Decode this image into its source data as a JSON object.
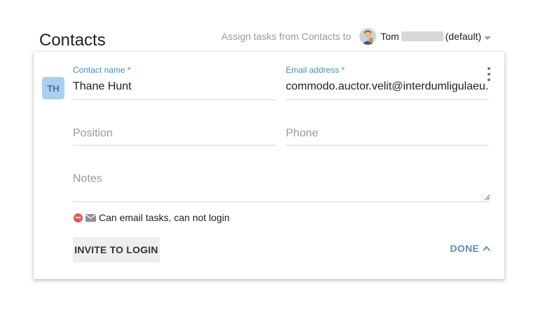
{
  "header": {
    "title": "Contacts",
    "assign_label": "Assign tasks from Contacts to",
    "assignee_name": "Tom",
    "assignee_default": "(default)"
  },
  "contact": {
    "initials": "TH",
    "name_label": "Contact name *",
    "name_value": "Thane Hunt",
    "email_label": "Email address *",
    "email_value": "commodo.auctor.velit@interdumligulaeu.",
    "position_placeholder": "Position",
    "phone_placeholder": "Phone",
    "notes_placeholder": "Notes",
    "status_text": "Can email tasks, can not login"
  },
  "actions": {
    "invite_label": "INVITE TO LOGIN",
    "done_label": "DONE"
  },
  "icons": {
    "kebab": "more-vert-icon",
    "status_blocked": "no-entry-icon",
    "status_mail": "envelope-icon",
    "done_chevron": "chevron-up-icon",
    "assignee_caret": "chevron-down-icon"
  },
  "colors": {
    "accent": "#4a8bc4",
    "badge_bg": "#a9cfee",
    "blocked": "#e25858"
  }
}
